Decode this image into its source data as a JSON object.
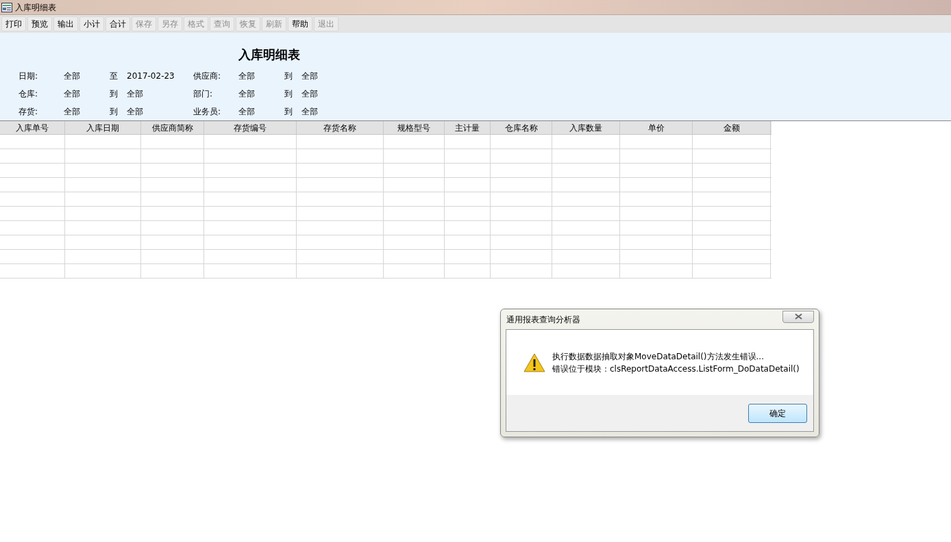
{
  "window": {
    "title": "入库明细表"
  },
  "toolbar": [
    {
      "label": "打印",
      "disabled": false
    },
    {
      "label": "预览",
      "disabled": false
    },
    {
      "label": "输出",
      "disabled": false
    },
    {
      "label": "小计",
      "disabled": false
    },
    {
      "label": "合计",
      "disabled": false
    },
    {
      "label": "保存",
      "disabled": true
    },
    {
      "label": "另存",
      "disabled": true
    },
    {
      "label": "格式",
      "disabled": true
    },
    {
      "label": "查询",
      "disabled": true
    },
    {
      "label": "恢复",
      "disabled": true
    },
    {
      "label": "刷新",
      "disabled": true
    },
    {
      "label": "帮助",
      "disabled": false
    },
    {
      "label": "退出",
      "disabled": true
    }
  ],
  "report": {
    "title": "入库明细表",
    "filters": [
      {
        "label": "日期:",
        "from": "全部",
        "separator": "至",
        "to": "2017-02-23"
      },
      {
        "label": "供应商:",
        "from": "全部",
        "separator": "到",
        "to": "全部"
      },
      {
        "label": "仓库:",
        "from": "全部",
        "separator": "到",
        "to": "全部"
      },
      {
        "label": "部门:",
        "from": "全部",
        "separator": "到",
        "to": "全部"
      },
      {
        "label": "存货:",
        "from": "全部",
        "separator": "到",
        "to": "全部"
      },
      {
        "label": "业务员:",
        "from": "全部",
        "separator": "到",
        "to": "全部"
      }
    ]
  },
  "table": {
    "columns": [
      "入库单号",
      "入库日期",
      "供应商简称",
      "存货编号",
      "存货名称",
      "规格型号",
      "主计量",
      "仓库名称",
      "入库数量",
      "单价",
      "金额"
    ]
  },
  "dialog": {
    "title": "通用报表查询分析器",
    "message_lines": [
      "执行数据数据抽取对象MoveDataDetail()方法发生错误...",
      "错误位于模块：clsReportDataAccess.ListForm_DoDataDetail()"
    ],
    "buttons": [
      "确定"
    ]
  }
}
